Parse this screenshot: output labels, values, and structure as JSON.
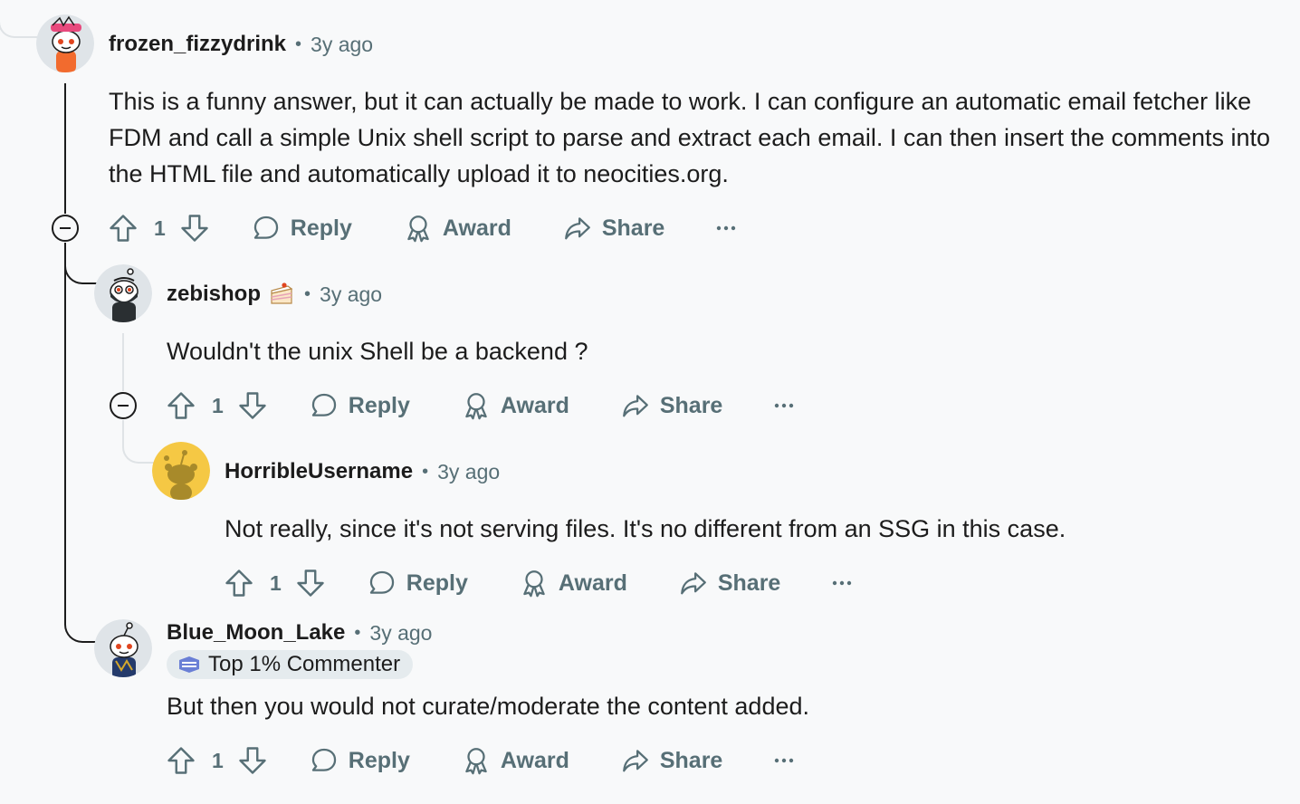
{
  "comments": [
    {
      "username": "frozen_fizzydrink",
      "time": "3y ago",
      "body": "This is a funny answer, but it can actually be made to work. I can configure an automatic email fetcher like FDM and call a simple Unix shell script to parse and extract each email. I can then insert the comments into the HTML file and automatically upload it to neocities.org.",
      "votes": "1",
      "reply_label": "Reply",
      "award_label": "Award",
      "share_label": "Share"
    },
    {
      "username": "zebishop",
      "time": "3y ago",
      "body": "Wouldn't the unix Shell be a backend ?",
      "votes": "1",
      "reply_label": "Reply",
      "award_label": "Award",
      "share_label": "Share"
    },
    {
      "username": "HorribleUsername",
      "time": "3y ago",
      "body": "Not really, since it's not serving files. It's no different from an SSG in this case.",
      "votes": "1",
      "reply_label": "Reply",
      "award_label": "Award",
      "share_label": "Share"
    },
    {
      "username": "Blue_Moon_Lake",
      "time": "3y ago",
      "badge": "Top 1% Commenter",
      "body": "But then you would not curate/moderate the content added.",
      "votes": "1",
      "reply_label": "Reply",
      "award_label": "Award",
      "share_label": "Share"
    }
  ],
  "separator": "•",
  "icons": [
    "upvote-icon",
    "downvote-icon",
    "reply-bubble-icon",
    "award-icon",
    "share-arrow-icon",
    "more-icon",
    "collapse-icon",
    "cake-flair-icon"
  ],
  "colors": {
    "text": "#1c1c1c",
    "muted": "#576f76",
    "background": "#f8f9fa",
    "badge_bg": "#e5ebee",
    "snoo_yellow": "#f5c844"
  }
}
